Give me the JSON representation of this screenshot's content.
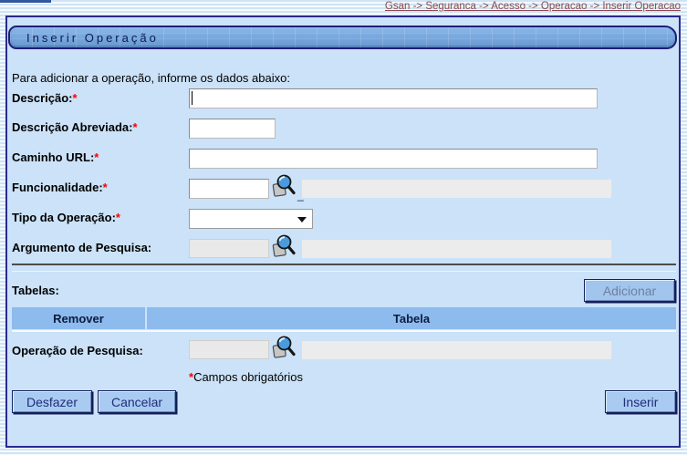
{
  "page": {
    "breadcrumb": "Gsan -> Seguranca -> Acesso -> Operacao -> Inserir Operacao",
    "title": "Inserir Operação",
    "intro": "Para adicionar a operação, informe os dados abaixo:"
  },
  "required_mark": "*",
  "form": {
    "descricao": {
      "label": "Descrição:",
      "value": "",
      "required": true
    },
    "descricao_abreviada": {
      "label": "Descrição Abreviada:",
      "value": "",
      "required": true
    },
    "caminho_url": {
      "label": "Caminho URL:",
      "value": "",
      "required": true
    },
    "funcionalidade": {
      "label": "Funcionalidade:",
      "value": "",
      "display_value": "",
      "required": true
    },
    "tipo_operacao": {
      "label": "Tipo da Operação:",
      "selected": "",
      "required": true
    },
    "argumento_pesquisa": {
      "label": "Argumento de Pesquisa:",
      "value": "",
      "display_value": "",
      "required": false
    },
    "operacao_pesquisa": {
      "label": "Operação de Pesquisa:",
      "value": "",
      "display_value": "",
      "required": false
    }
  },
  "tabelas": {
    "label": "Tabelas:",
    "add_button": "Adicionar",
    "columns": [
      "Remover",
      "Tabela"
    ],
    "rows": []
  },
  "footer": {
    "required_note": "Campos obrigatórios",
    "buttons": {
      "undo": "Desfazer",
      "cancel": "Cancelar",
      "submit": "Inserir"
    }
  },
  "icons": {
    "search": "magnifier-over-document",
    "select_arrow": "down-triangle"
  },
  "colors": {
    "header_bar": "#76a6dd",
    "panel_bg": "#cbe2f8",
    "panel_border": "#2a2a8e",
    "table_header_bg": "#8dbbee",
    "button_bg": "#a9cbf1",
    "button_text": "#1f2d7b",
    "breadcrumb_text": "#8d4a4e",
    "required": "#ff0000",
    "disabled_field_bg": "#ececec"
  }
}
